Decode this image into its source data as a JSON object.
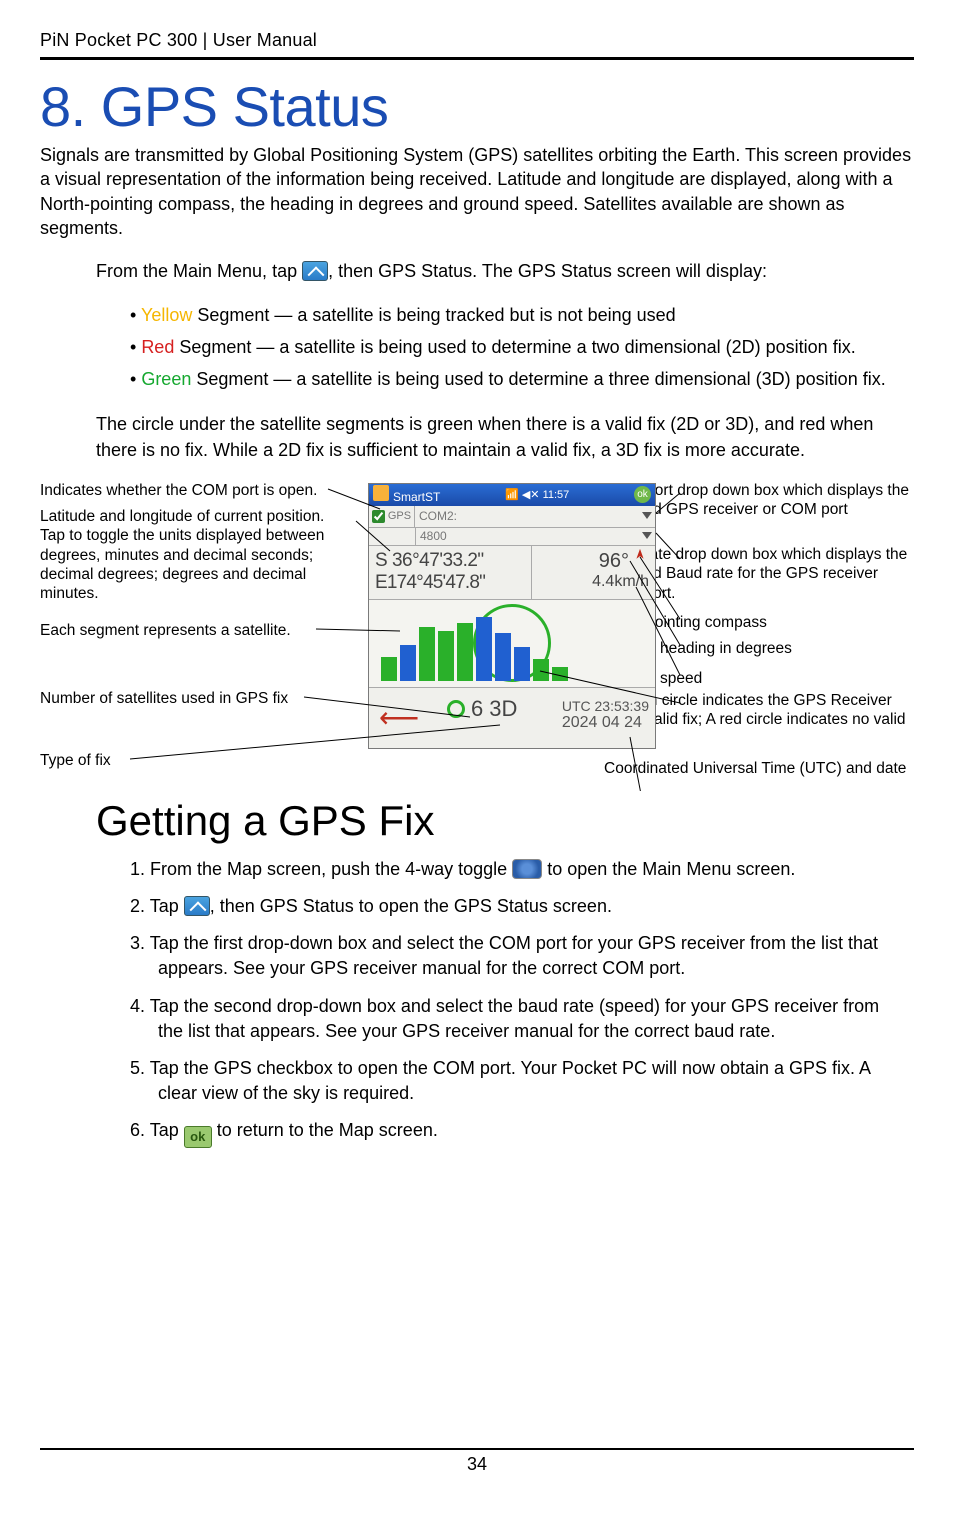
{
  "header": "PiN Pocket PC 300 | User Manual",
  "title": "8. GPS Status",
  "intro": "Signals are transmitted by Global Positioning System (GPS) satellites orbiting the Earth. This screen provides a visual representation of the information being received. Latitude and longitude are displayed, along with a North-pointing compass, the heading in degrees and ground speed. Satellites available are shown as segments.",
  "leadline_pre": "From the Main Menu, tap ",
  "leadline_post": ", then GPS Status. The GPS Status screen will display:",
  "bullets": {
    "yellow_word": "Yellow",
    "yellow_rest": " Segment — a satellite is being tracked but is not being used",
    "red_word": "Red",
    "red_rest": " Segment — a satellite is being used to determine a two dimensional (2D) position fix.",
    "green_word": "Green",
    "green_rest": " Segment — a satellite is being used to determine a three dimensional (3D) position fix."
  },
  "circle_note": "The circle under the satellite segments is green when there is a valid fix (2D or 3D), and red when there is no fix. While a 2D fix is sufficient to maintain a valid fix, a 3D fix is more accurate.",
  "labels_left": {
    "com_open": "Indicates whether the COM port is open.",
    "latlon": "Latitude and longitude of current position. Tap to toggle the units displayed between degrees, minutes and decimal seconds; decimal degrees; degrees and decimal minutes.",
    "segment": "Each segment represents a satellite.",
    "numsat": "Number of satellites used in GPS fix",
    "fixtype": "Type of fix"
  },
  "labels_right": {
    "comport": "COM Port drop down box which displays the selected GPS receiver or COM port",
    "baud": "Baud rate drop down box which displays the selected Baud rate for the GPS receiver COM port.",
    "compass": "North pointing compass",
    "heading": "Current heading in degrees",
    "speed": "Ground speed",
    "greencirc": "A green circle indicates the GPS Receiver has a valid fix; A red circle indicates no valid fix",
    "utc": "Coordinated Universal Time (UTC) and date"
  },
  "screenshot": {
    "app": "SmartST",
    "time": "11:57",
    "gps_label": "GPS",
    "com_dd": "COM2:",
    "baud_dd": "4800",
    "lat": "S  36°47'33.2\"",
    "lon": "E174°45'47.8\"",
    "heading": "96°",
    "speed": "4.4km/h",
    "fix_num": "6",
    "fix_type": "3D",
    "utc_label": "UTC 23:53:39",
    "utc_date": "2024 04 24"
  },
  "subtitle": "Getting a GPS Fix",
  "steps": {
    "s1a": "1. From the Map screen, push the 4-way toggle ",
    "s1b": " to open the Main Menu screen.",
    "s2a": "2. Tap ",
    "s2b": ", then GPS Status to open the GPS Status screen.",
    "s3": "3. Tap the first drop-down box and select the COM port for your GPS receiver from the list that",
    "s3c": "appears. See your GPS receiver manual for the correct COM port.",
    "s4": "4. Tap the second drop-down box and select the baud rate (speed) for your GPS receiver from",
    "s4c": "the list that appears. See your GPS receiver manual for the correct baud rate.",
    "s5": "5. Tap the GPS checkbox to open the COM port. Your Pocket PC will now obtain a GPS fix. A",
    "s5c": "clear view of the sky is required.",
    "s6a": "6. Tap ",
    "s6b": " to return to the Map screen."
  },
  "page_number": "34"
}
